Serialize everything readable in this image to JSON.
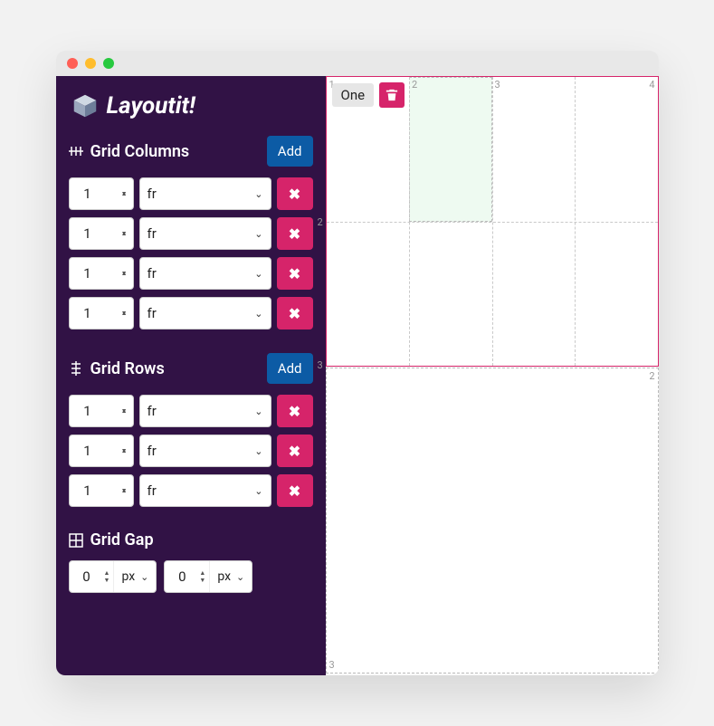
{
  "app": {
    "title": "Layoutit!"
  },
  "sections": {
    "columns": {
      "title": "Grid Columns",
      "add_label": "Add",
      "tracks": [
        {
          "value": "1",
          "unit": "fr"
        },
        {
          "value": "1",
          "unit": "fr"
        },
        {
          "value": "1",
          "unit": "fr"
        },
        {
          "value": "1",
          "unit": "fr"
        }
      ]
    },
    "rows": {
      "title": "Grid Rows",
      "add_label": "Add",
      "tracks": [
        {
          "value": "1",
          "unit": "fr"
        },
        {
          "value": "1",
          "unit": "fr"
        },
        {
          "value": "1",
          "unit": "fr"
        }
      ]
    },
    "gap": {
      "title": "Grid Gap",
      "col_gap": {
        "value": "0",
        "unit": "px"
      },
      "row_gap": {
        "value": "0",
        "unit": "px"
      }
    }
  },
  "canvas": {
    "area_name": "One",
    "col_labels": [
      "1",
      "2",
      "3",
      "4"
    ],
    "row_labels": [
      "2",
      "3"
    ],
    "second_labels": [
      "2",
      "3"
    ]
  }
}
